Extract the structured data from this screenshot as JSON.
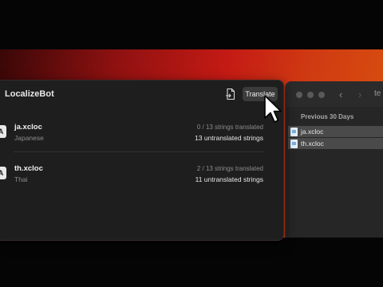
{
  "app": {
    "title": "LocalizeBot"
  },
  "toolbar": {
    "translate_label": "Translate"
  },
  "files": [
    {
      "name": "ja.xcloc",
      "language": "Japanese",
      "progress": "0 / 13 strings translated",
      "untranslated": "13 untranslated strings"
    },
    {
      "name": "th.xcloc",
      "language": "Thai",
      "progress": "2 / 13 strings translated",
      "untranslated": "11 untranslated strings"
    }
  ],
  "file_icon_glyph": "A",
  "finder": {
    "title_fragment": "te",
    "section": "Previous 30 Days",
    "items": [
      "ja.xcloc",
      "th.xcloc"
    ]
  },
  "colors": {
    "accent_wallpaper": "#c41a14",
    "window_bg": "#1e1e1e",
    "button_bg": "#3b3b3b"
  }
}
